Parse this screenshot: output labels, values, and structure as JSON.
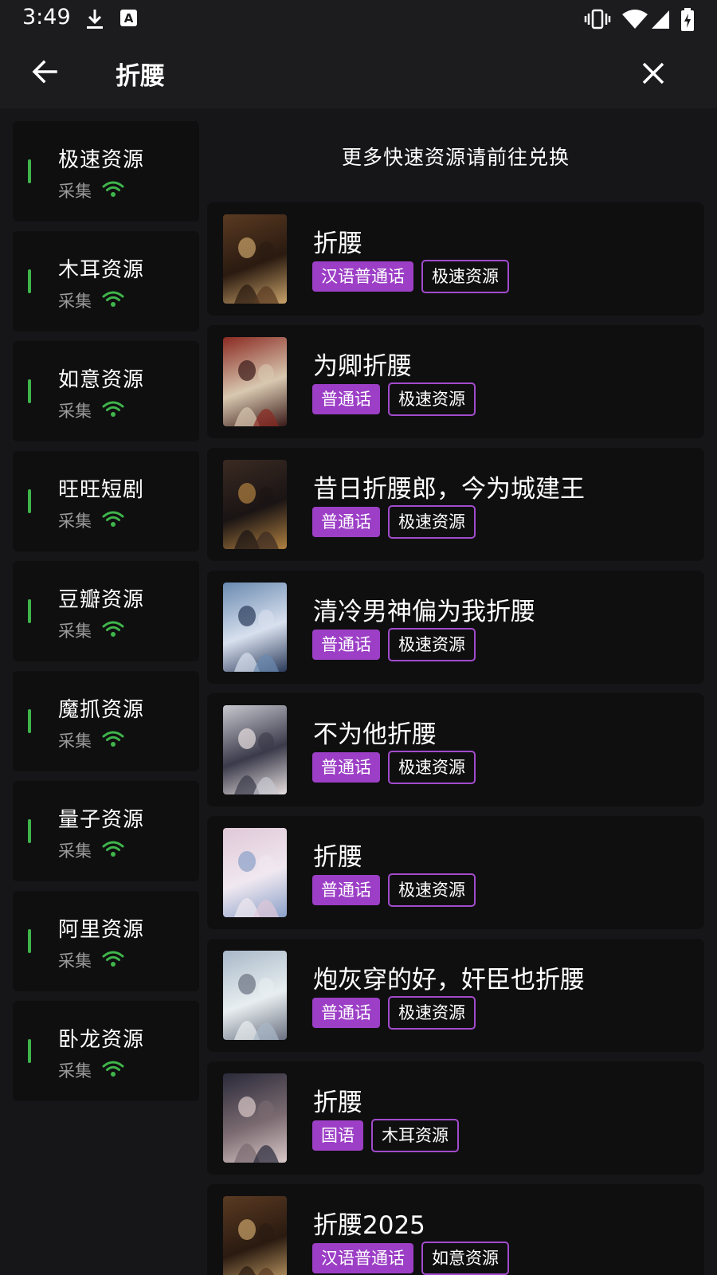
{
  "status_bar": {
    "time": "3:49",
    "icons": [
      "download-icon",
      "a-badge-icon",
      "vibrate-icon",
      "wifi-icon",
      "signal-icon",
      "battery-icon"
    ]
  },
  "header": {
    "title": "折腰",
    "back_icon": "arrow-left-icon",
    "close_icon": "close-icon"
  },
  "sidebar": {
    "items": [
      {
        "name": "极速资源",
        "sub": "采集"
      },
      {
        "name": "木耳资源",
        "sub": "采集"
      },
      {
        "name": "如意资源",
        "sub": "采集"
      },
      {
        "name": "旺旺短剧",
        "sub": "采集"
      },
      {
        "name": "豆瓣资源",
        "sub": "采集"
      },
      {
        "name": "魔抓资源",
        "sub": "采集"
      },
      {
        "name": "量子资源",
        "sub": "采集"
      },
      {
        "name": "阿里资源",
        "sub": "采集"
      },
      {
        "name": "卧龙资源",
        "sub": "采集"
      }
    ]
  },
  "results": {
    "banner": "更多快速资源请前往兑换",
    "items": [
      {
        "title": "折腰",
        "lang": "汉语普通话",
        "source": "极速资源"
      },
      {
        "title": "为卿折腰",
        "lang": "普通话",
        "source": "极速资源"
      },
      {
        "title": "昔日折腰郎，今为城建王",
        "lang": "普通话",
        "source": "极速资源"
      },
      {
        "title": "清冷男神偏为我折腰",
        "lang": "普通话",
        "source": "极速资源"
      },
      {
        "title": "不为他折腰",
        "lang": "普通话",
        "source": "极速资源"
      },
      {
        "title": "折腰",
        "lang": "普通话",
        "source": "极速资源"
      },
      {
        "title": "炮灰穿的好，奸臣也折腰",
        "lang": "普通话",
        "source": "极速资源"
      },
      {
        "title": "折腰",
        "lang": "国语",
        "source": "木耳资源"
      },
      {
        "title": "折腰2025",
        "lang": "汉语普通话",
        "source": "如意资源"
      }
    ]
  },
  "colors": {
    "accent_purple": "#9c3fc6",
    "indicator_green": "#3fb54b",
    "card_bg": "#0f0f10"
  }
}
